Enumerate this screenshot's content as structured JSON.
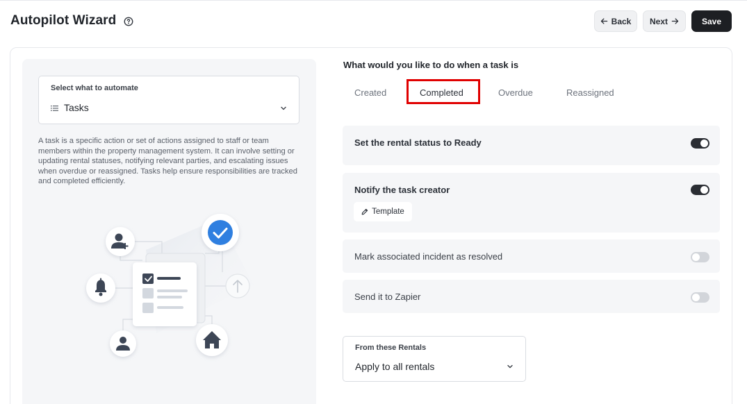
{
  "header": {
    "title": "Autopilot Wizard",
    "back_label": "Back",
    "next_label": "Next",
    "save_label": "Save"
  },
  "left": {
    "select_label": "Select what to automate",
    "select_value": "Tasks",
    "description": "A task is a specific action or set of actions assigned to staff or team members within the property management system. It can involve setting or updating rental statuses, notifying relevant parties, and escalating issues when overdue or reassigned. Tasks help ensure responsibilities are tracked and completed efficiently."
  },
  "right": {
    "section_title": "What would you like to do when a task is",
    "tabs": [
      {
        "label": "Created",
        "selected": false
      },
      {
        "label": "Completed",
        "selected": true
      },
      {
        "label": "Overdue",
        "selected": false
      },
      {
        "label": "Reassigned",
        "selected": false
      }
    ],
    "options": [
      {
        "label": "Set the rental status to Ready",
        "enabled": true
      },
      {
        "label": "Notify the task creator",
        "enabled": true,
        "button_label": "Template"
      },
      {
        "label": "Mark associated incident as resolved",
        "enabled": false
      },
      {
        "label": "Send it to Zapier",
        "enabled": false
      }
    ],
    "rentals": {
      "label": "From these Rentals",
      "value": "Apply to all rentals"
    }
  },
  "colors": {
    "primary": "#1d1f23",
    "highlight": "#e00000",
    "check_blue": "#2f7fe0",
    "panel_bg": "#f5f6f8"
  },
  "icons": [
    "help-icon",
    "arrow-left-icon",
    "arrow-right-icon",
    "list-icon",
    "chevron-down-icon",
    "pencil-icon",
    "add-user-icon",
    "bell-icon",
    "user-icon",
    "check-circle-icon",
    "arrow-up-icon",
    "home-icon",
    "checklist-icon"
  ]
}
